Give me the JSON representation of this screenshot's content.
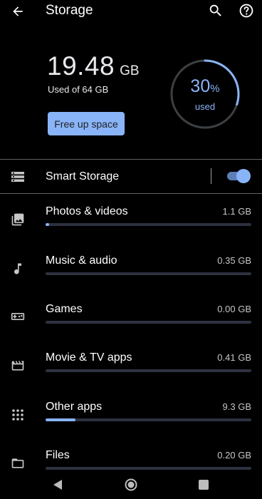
{
  "appbar": {
    "title": "Storage",
    "back_icon": "arrow-back-icon",
    "search_icon": "search-icon",
    "help_icon": "help-icon"
  },
  "summary": {
    "used_value": "19.48",
    "used_unit": "GB",
    "used_of": "Used of 64 GB",
    "free_button": "Free up space",
    "percent": "30",
    "percent_sign": "%",
    "percent_label": "used",
    "percent_fraction": 0.3
  },
  "smart_storage": {
    "label": "Smart Storage",
    "icon": "storage-icon",
    "enabled": true
  },
  "categories": [
    {
      "name": "Photos & videos",
      "size": "1.1 GB",
      "icon": "photos-icon",
      "fraction": 0.017
    },
    {
      "name": "Music & audio",
      "size": "0.35 GB",
      "icon": "music-note-icon",
      "fraction": 0.0
    },
    {
      "name": "Games",
      "size": "0.00 GB",
      "icon": "games-icon",
      "fraction": 0.0
    },
    {
      "name": "Movie & TV apps",
      "size": "0.41 GB",
      "icon": "movie-icon",
      "fraction": 0.0
    },
    {
      "name": "Other apps",
      "size": "9.3 GB",
      "icon": "apps-grid-icon",
      "fraction": 0.145
    },
    {
      "name": "Files",
      "size": "0.20 GB",
      "icon": "folder-icon",
      "fraction": 0.0
    }
  ],
  "colors": {
    "accent": "#8ab4f8",
    "background": "#000000",
    "track": "#2d3140"
  }
}
